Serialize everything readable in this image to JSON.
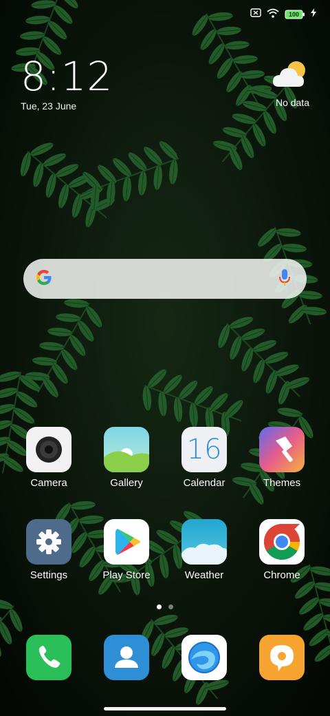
{
  "status_bar": {
    "battery_level": "100",
    "icons": [
      "no-sim-icon",
      "wifi-icon",
      "battery-icon",
      "charging-icon"
    ]
  },
  "clock": {
    "time": "8:12",
    "date": "Tue, 23 June"
  },
  "weather": {
    "text": "No data",
    "icon": "partly-cloudy-icon"
  },
  "search": {
    "icons": [
      "google-logo-icon",
      "microphone-icon"
    ]
  },
  "apps": [
    {
      "label": "Camera",
      "icon": "camera-icon"
    },
    {
      "label": "Gallery",
      "icon": "gallery-icon"
    },
    {
      "label": "Calendar",
      "icon": "calendar-icon",
      "icon_text": "16"
    },
    {
      "label": "Themes",
      "icon": "themes-icon"
    },
    {
      "label": "Settings",
      "icon": "gear-icon"
    },
    {
      "label": "Play Store",
      "icon": "play-store-icon"
    },
    {
      "label": "Weather",
      "icon": "weather-icon"
    },
    {
      "label": "Chrome",
      "icon": "chrome-icon"
    }
  ],
  "dock": [
    {
      "icon": "phone-icon"
    },
    {
      "icon": "contacts-icon"
    },
    {
      "icon": "browser-icon"
    },
    {
      "icon": "messaging-icon"
    }
  ],
  "pager": {
    "pages": 2,
    "current": 1
  },
  "colors": {
    "wallpaper_dark": "#0b160c",
    "leaf": "#2f7a38",
    "phone_green": "#2bbf5a",
    "contacts_blue": "#2f8fd6",
    "messaging_orange": "#f7a531",
    "battery_green": "#6fe36a"
  }
}
